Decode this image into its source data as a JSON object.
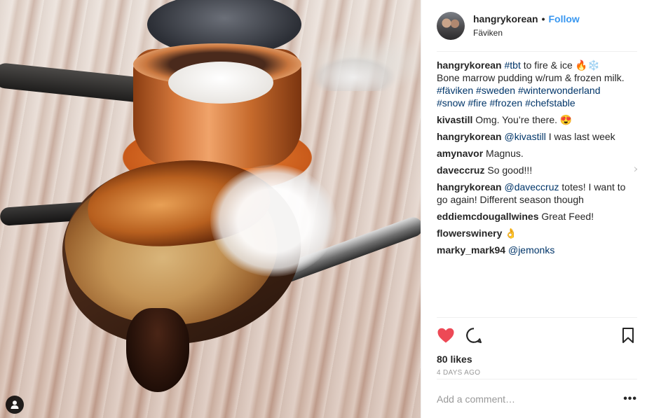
{
  "post": {
    "username": "hangrykorean",
    "follow_label": "Follow",
    "separator": "•",
    "location": "Fäviken",
    "caption": {
      "user": "hangrykorean",
      "tbt": "#tbt",
      "text1": " to fire & ice 🔥❄️",
      "text2": " Bone marrow pudding w/rum & frozen milk. ",
      "tags": [
        "#fäviken",
        "#sweden",
        "#winterwonderland",
        "#snow",
        "#fire",
        "#frozen",
        "#chefstable"
      ]
    },
    "comments": [
      {
        "user": "kivastill",
        "mention": "",
        "text": "Omg. You’re there. 😍"
      },
      {
        "user": "hangrykorean",
        "mention": "@kivastill",
        "text": " I was last week"
      },
      {
        "user": "amynavor",
        "mention": "",
        "text": "Magnus."
      },
      {
        "user": "daveccruz",
        "mention": "",
        "text": "So good!!!"
      },
      {
        "user": "hangrykorean",
        "mention": "@daveccruz",
        "text": " totes! I want to go again! Different season though"
      },
      {
        "user": "eddiemcdougallwines",
        "mention": "",
        "text": "Great Feed!"
      },
      {
        "user": "flowerswinery",
        "mention": "",
        "text": "👌"
      },
      {
        "user": "marky_mark94",
        "mention": "@jemonks",
        "text": ""
      }
    ],
    "close_symbol": "×",
    "likes": "80 likes",
    "timestamp": "4 DAYS AGO",
    "add_comment_placeholder": "Add a comment…",
    "more_label": "•••"
  },
  "icons": {
    "like": "heart-icon",
    "comment": "speech-bubble-icon",
    "save": "bookmark-icon",
    "user_tag": "person-icon",
    "options": "ellipsis-icon"
  },
  "colors": {
    "link": "#3897f0",
    "hashtag": "#003569",
    "heart": "#ed4956",
    "muted": "#999999",
    "text": "#262626"
  }
}
